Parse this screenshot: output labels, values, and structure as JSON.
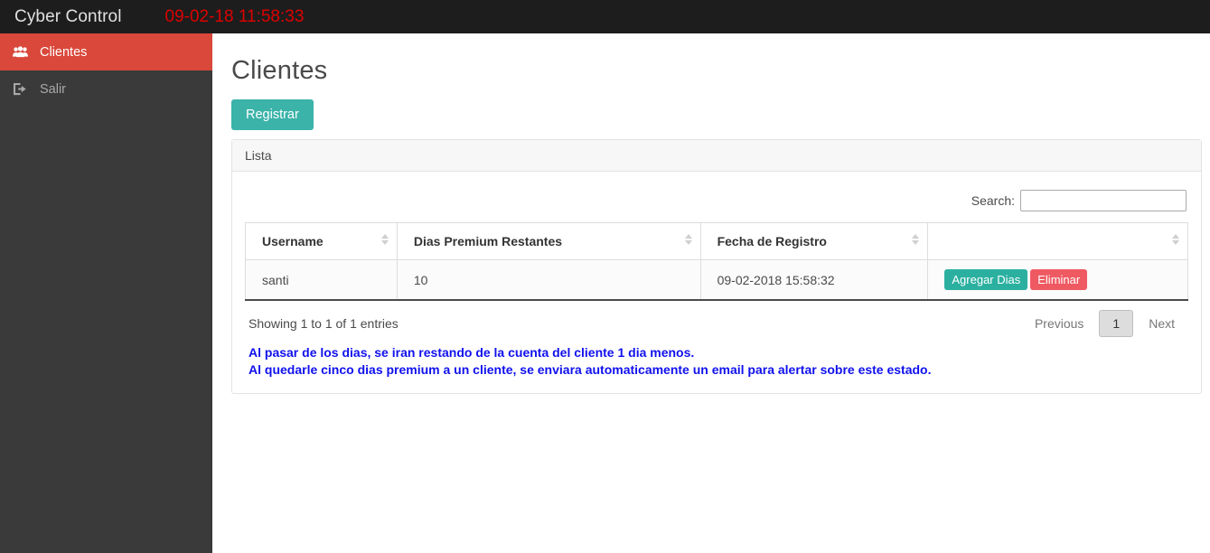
{
  "header": {
    "brand": "Cyber Control",
    "datetime": "09-02-18 11:58:33",
    "background": "#1d1d1d",
    "datetime_color": "#dd0000"
  },
  "sidebar": {
    "background": "#3a3a3a",
    "active_color": "#d9483a",
    "items": [
      {
        "label": "Clientes",
        "icon": "users-icon",
        "active": true
      },
      {
        "label": "Salir",
        "icon": "sign-out-icon",
        "active": false
      }
    ]
  },
  "main": {
    "page_title": "Clientes",
    "register_button": "Registrar",
    "register_button_color": "#3bb3a9",
    "panel_title": "Lista",
    "search": {
      "label": "Search:",
      "value": "",
      "placeholder": ""
    },
    "table": {
      "columns": [
        "Username",
        "Dias Premium Restantes",
        "Fecha de Registro",
        ""
      ],
      "rows": [
        {
          "username": "santi",
          "dias_premium_restantes": "10",
          "fecha_de_registro": "09-02-2018 15:58:32",
          "actions": {
            "add_days": "Agregar Dias",
            "delete": "Eliminar",
            "add_days_color": "#2bb0a0",
            "delete_color": "#ef5a62"
          }
        }
      ]
    },
    "footer": {
      "info": "Showing 1 to 1 of 1 entries",
      "previous": "Previous",
      "page": "1",
      "next": "Next"
    },
    "notes": {
      "color": "#1010ee",
      "line1": "Al pasar de los dias, se iran restando de la cuenta del cliente 1 dia menos.",
      "line2": "Al quedarle cinco dias premium a un cliente, se enviara automaticamente un email para alertar sobre este estado."
    }
  }
}
